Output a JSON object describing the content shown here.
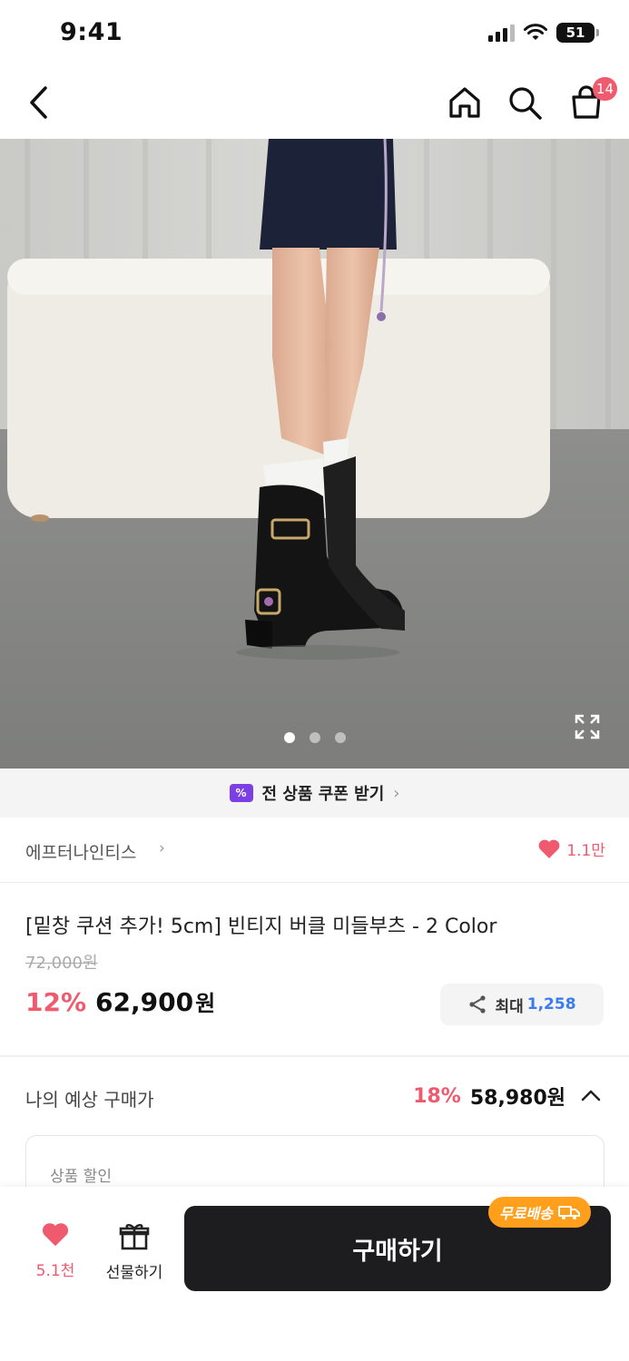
{
  "status_bar": {
    "time": "9:41",
    "battery": "51"
  },
  "nav": {
    "cart_count": "14"
  },
  "coupon": {
    "label": "전 상품 쿠폰 받기"
  },
  "brand": {
    "name": "에프터나인티스",
    "like_count": "1.1만"
  },
  "product": {
    "title": "[밑창 쿠션 추가! 5cm] 빈티지 버클 미들부츠 - 2 Color",
    "original_price": "72,000원",
    "discount": "12%",
    "price": "62,900",
    "currency": "원",
    "share_label": "최대",
    "share_value": "1,258"
  },
  "expected": {
    "label": "나의 예상 구매가",
    "discount": "18%",
    "price": "58,980원",
    "detail_label": "상품 할인"
  },
  "bottom": {
    "like_count": "5.1천",
    "gift_label": "선물하기",
    "buy_label": "구매하기",
    "free_shipping": "무료배송"
  },
  "carousel": {
    "total": 3,
    "active": 0
  },
  "colors": {
    "accent": "#f05a6e",
    "dark": "#1d1d1f",
    "blue": "#3b7bf0",
    "orange": "#ff9f1c",
    "coupon_purple": "#7b3fe4"
  }
}
